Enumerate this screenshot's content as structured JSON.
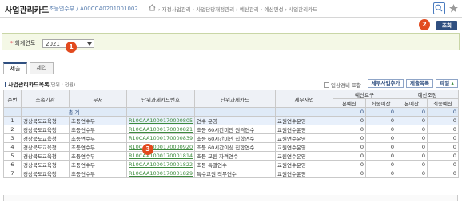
{
  "header": {
    "title": "사업관리카드",
    "subtitle": "초등연수부 / A00CCA0201001002",
    "breadcrumb": "› 재정사업관리 › 사업담당재정관리 › 예산관리 › 예산편성 › 사업관리카드"
  },
  "actions": {
    "search_label": "조회"
  },
  "condition": {
    "label": "회계연도",
    "required_mark": "*",
    "year_value": "2021"
  },
  "tabs": [
    "세출",
    "세입"
  ],
  "list": {
    "title": "사업관리카드목록",
    "unit": "(단위 : 천원)",
    "general_checkbox_label": "일상경비 포함",
    "btn_detail_add": "세부사업추가",
    "btn_delete": "제출목록",
    "btn_file": "파일"
  },
  "table": {
    "headers": {
      "no": "순번",
      "agency": "소속기관",
      "dept": "부서",
      "code": "단위과제카드번호",
      "card": "단위과제카드",
      "detail": "세부사업",
      "req": "예산요구",
      "adj": "예산조정",
      "base": "본예산",
      "final": "최종예산"
    },
    "total_label": "총 계",
    "total_values": [
      "0",
      "0",
      "0",
      "0"
    ],
    "rows": [
      {
        "no": "1",
        "agency": "경상북도교육청",
        "dept": "초등연수부",
        "code": "R10CAA1000170000805",
        "card": "연수 운영",
        "detail": "교원연수운영",
        "v1": "0",
        "v2": "0",
        "v3": "0",
        "v4": "0"
      },
      {
        "no": "2",
        "agency": "경상북도교육청",
        "dept": "초등연수부",
        "code": "R10CAA1000170000821",
        "card": "초등 60시간미만 원격연수",
        "detail": "교원연수운영",
        "v1": "0",
        "v2": "0",
        "v3": "0",
        "v4": "0"
      },
      {
        "no": "3",
        "agency": "경상북도교육청",
        "dept": "초등연수부",
        "code": "R10CAA1000170000839",
        "card": "초등 60시간미만 집합연수",
        "detail": "교원연수운영",
        "v1": "0",
        "v2": "0",
        "v3": "0",
        "v4": "0"
      },
      {
        "no": "4",
        "agency": "경상북도교육청",
        "dept": "초등연수부",
        "code": "R10CAA1000170000920",
        "card": "초등 60시간이상 집합연수",
        "detail": "교원연수운영",
        "v1": "0",
        "v2": "0",
        "v3": "0",
        "v4": "0"
      },
      {
        "no": "5",
        "agency": "경상북도교육청",
        "dept": "초등연수부",
        "code": "R10CAA1000170001814",
        "card": "초등 교원 자격연수",
        "detail": "교원연수운영",
        "v1": "0",
        "v2": "0",
        "v3": "0",
        "v4": "0"
      },
      {
        "no": "6",
        "agency": "경상북도교육청",
        "dept": "초등연수부",
        "code": "R10CAA1000170001822",
        "card": "초등 특별연수",
        "detail": "교원연수운영",
        "v1": "0",
        "v2": "0",
        "v3": "0",
        "v4": "0"
      },
      {
        "no": "7",
        "agency": "경상북도교육청",
        "dept": "초등연수부",
        "code": "R10CAA1000170001829",
        "card": "특수교원 직무연수",
        "detail": "교원연수운영",
        "v1": "0",
        "v2": "0",
        "v3": "0",
        "v4": "0"
      }
    ]
  },
  "callouts": [
    "1",
    "2",
    "3"
  ],
  "colors": {
    "accent": "#2f4f80",
    "callout": "#e24a1e",
    "condition_bg": "#f4f8e6",
    "link": "#3c8a3c"
  }
}
